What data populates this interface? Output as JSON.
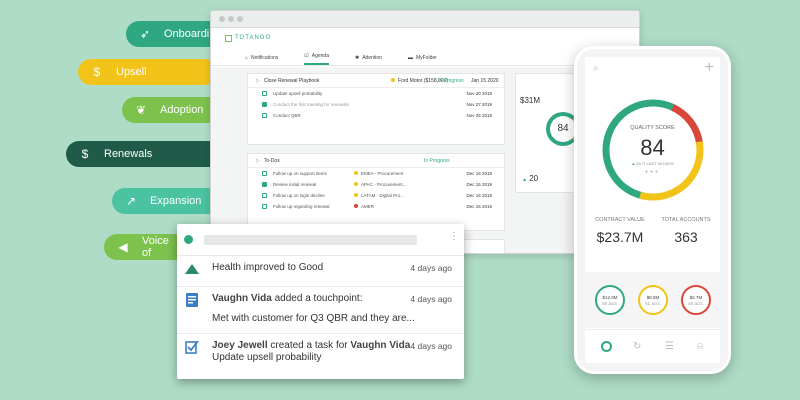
{
  "pills": [
    {
      "label": "Onboarding",
      "icon": "rocket-icon",
      "color": "#2fa882"
    },
    {
      "label": "Upsell",
      "icon": "dollar-icon",
      "color": "#f2c318"
    },
    {
      "label": "Adoption",
      "icon": "leaf-icon",
      "color": "#7cc24d"
    },
    {
      "label": "Renewals",
      "icon": "dollar-icon",
      "color": "#1f5b48"
    },
    {
      "label": "Expansion",
      "icon": "trend-icon",
      "color": "#4bc2a0"
    },
    {
      "label": "Voice of",
      "icon": "megaphone-icon",
      "color": "#7cc24d"
    }
  ],
  "desktop": {
    "logo": "TOTANGO",
    "nav": [
      "Notifications",
      "Agenda",
      "Attention",
      "MyFolder"
    ],
    "play1": {
      "title": "Close Renewal Playbook",
      "account": "Ford Motor ($158,000)",
      "status": "In Progress",
      "date": "Jan 15 2020",
      "tasks": [
        {
          "label": "Update upsell probability",
          "date": "Nov 20 2019",
          "done": false
        },
        {
          "label": "Conduct the first meeting for renewals",
          "date": "Nov 27 2019",
          "done": true
        },
        {
          "label": "Conduct QBR",
          "date": "Nov 25 2019",
          "done": false
        }
      ]
    },
    "play2": {
      "title": "To-Dos",
      "status": "In Progress",
      "tasks": [
        {
          "label": "Follow up on support items",
          "account": "EMEA - Procurement",
          "date": "Dec 15 2019",
          "done": false
        },
        {
          "label": "Review initial renewal",
          "account": "APAC - Procurement...",
          "date": "Dec 15 2019",
          "done": true
        },
        {
          "label": "Follow up on login decline",
          "account": "LATAM - Digital Pro...",
          "date": "Dec 15 2019",
          "done": false
        },
        {
          "label": "Follow up regarding renewal",
          "account": "AMER",
          "date": "Dec 15 2019",
          "done": false
        }
      ]
    },
    "side": {
      "label1": "$31M",
      "label2": "20",
      "value": "84"
    }
  },
  "notifications": [
    {
      "icon": "up-triangle-icon",
      "text": "Health improved to Good",
      "time": "4 days ago"
    },
    {
      "icon": "document-icon",
      "actor": "Vaughn Vida",
      "action": " added a touchpoint:",
      "body": "Met with customer for Q3 QBR and they are...",
      "time": "4 days ago"
    },
    {
      "icon": "checkbox-icon",
      "actor": "Joey Jewell",
      "action": " created a task for ",
      "target": "Vaughn Vida",
      "body": "Update upsell probability",
      "time": "4 days ago"
    }
  ],
  "phone": {
    "score_label": "QUALITY SCORE",
    "score": "84",
    "score_sub": "20 IT LAST 90 DAYS",
    "contract_label": "CONTRACT VALUE",
    "contract_value": "$23.7M",
    "accounts_label": "TOTAL ACCOUNTS",
    "accounts_value": "363",
    "minis": [
      {
        "value": "$12.9M",
        "sub": "50 acct.",
        "color": "#2fa882"
      },
      {
        "value": "$8.9M",
        "sub": "51 acct.",
        "color": "#f2c318"
      },
      {
        "value": "$2.7M",
        "sub": "45 acct.",
        "color": "#d9473b"
      }
    ]
  }
}
